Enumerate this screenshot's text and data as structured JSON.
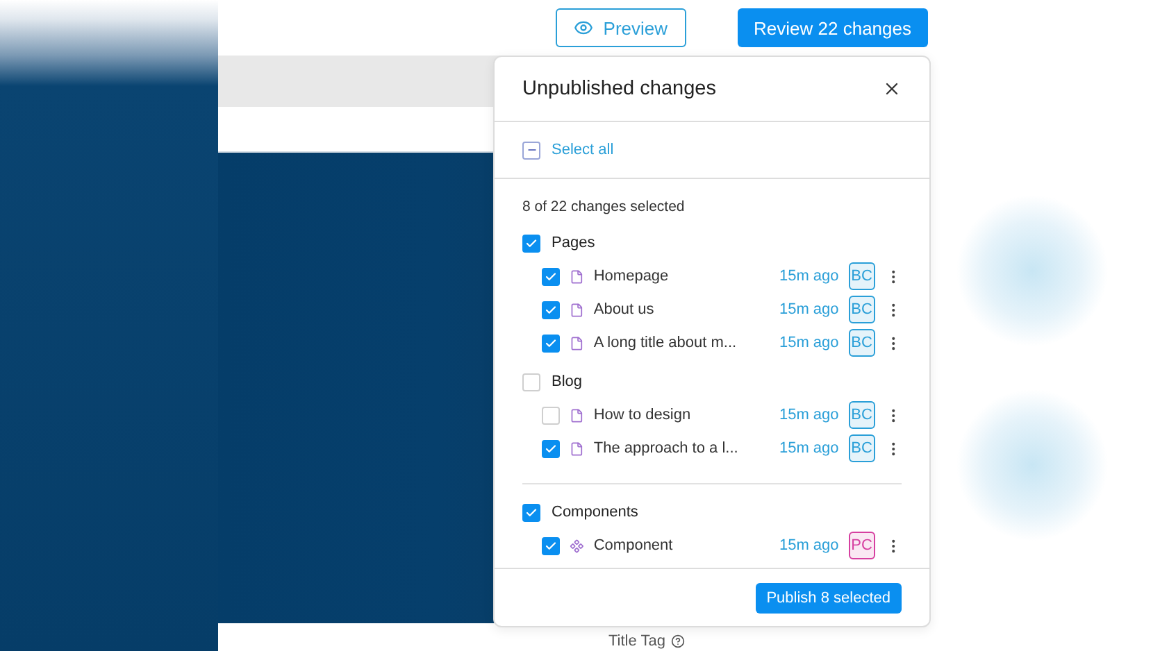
{
  "toolbar": {
    "preview_button": "Preview",
    "review_button": "Review 22 changes"
  },
  "panel": {
    "title": "Unpublished changes",
    "select_all": {
      "label": "Select all",
      "indeterminate": true
    },
    "summary": "8 of 22 changes selected",
    "groups": [
      {
        "label": "Pages",
        "checked": true,
        "separated": false,
        "items": [
          {
            "title": "Homepage",
            "kind": "page",
            "checked": true,
            "time": "15m ago",
            "author": "BC",
            "color": "#2a9fd8"
          },
          {
            "title": "About us",
            "kind": "page",
            "checked": true,
            "time": "15m ago",
            "author": "BC",
            "color": "#2a9fd8"
          },
          {
            "title": "A long title about m...",
            "kind": "page",
            "checked": true,
            "time": "15m ago",
            "author": "BC",
            "color": "#2a9fd8"
          }
        ]
      },
      {
        "label": "Blog",
        "checked": false,
        "separated": false,
        "items": [
          {
            "title": "How to design",
            "kind": "page",
            "checked": false,
            "time": "15m ago",
            "author": "BC",
            "color": "#2a9fd8"
          },
          {
            "title": "The approach to a l...",
            "kind": "page",
            "checked": true,
            "time": "15m ago",
            "author": "BC",
            "color": "#2a9fd8"
          }
        ]
      },
      {
        "label": "Components",
        "checked": true,
        "separated": true,
        "items": [
          {
            "title": "Component",
            "kind": "component",
            "checked": true,
            "time": "15m ago",
            "author": "PC",
            "color": "#d63fa0"
          }
        ]
      }
    ],
    "publish_button": "Publish 8 selected"
  },
  "background": {
    "field_label": "Title Tag"
  }
}
